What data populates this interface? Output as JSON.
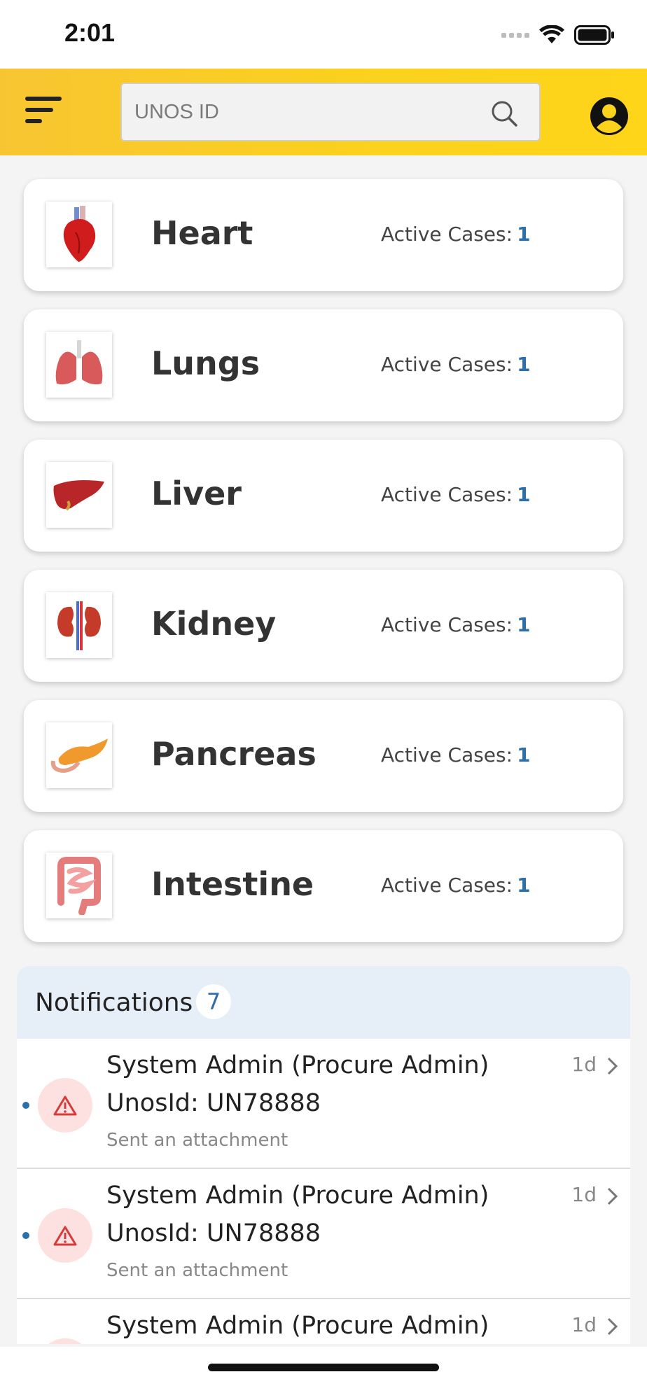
{
  "status_bar": {
    "time": "2:01"
  },
  "header": {
    "search_placeholder": "UNOS ID"
  },
  "organs": [
    {
      "name": "Heart",
      "cases_label": "Active Cases:",
      "cases": "1",
      "icon": "heart-icon"
    },
    {
      "name": "Lungs",
      "cases_label": "Active Cases:",
      "cases": "1",
      "icon": "lungs-icon"
    },
    {
      "name": "Liver",
      "cases_label": "Active Cases:",
      "cases": "1",
      "icon": "liver-icon"
    },
    {
      "name": "Kidney",
      "cases_label": "Active Cases:",
      "cases": "1",
      "icon": "kidney-icon"
    },
    {
      "name": "Pancreas",
      "cases_label": "Active Cases:",
      "cases": "1",
      "icon": "pancreas-icon"
    },
    {
      "name": "Intestine",
      "cases_label": "Active Cases:",
      "cases": "1",
      "icon": "intestine-icon"
    }
  ],
  "notifications": {
    "title": "Notifications",
    "count": "7",
    "items": [
      {
        "sender": "System Admin (Procure Admin)",
        "unos": "UnosId: UN78888",
        "message": "Sent an attachment",
        "time": "1d"
      },
      {
        "sender": "System Admin (Procure Admin)",
        "unos": "UnosId: UN78888",
        "message": "Sent an attachment",
        "time": "1d"
      },
      {
        "sender": "System Admin (Procure Admin)",
        "unos": "",
        "message": "",
        "time": "1d"
      }
    ]
  },
  "colors": {
    "header_yellow": "#fbd21c",
    "accent_blue": "#2f6fa8",
    "notif_header_bg": "#e6eef7"
  }
}
